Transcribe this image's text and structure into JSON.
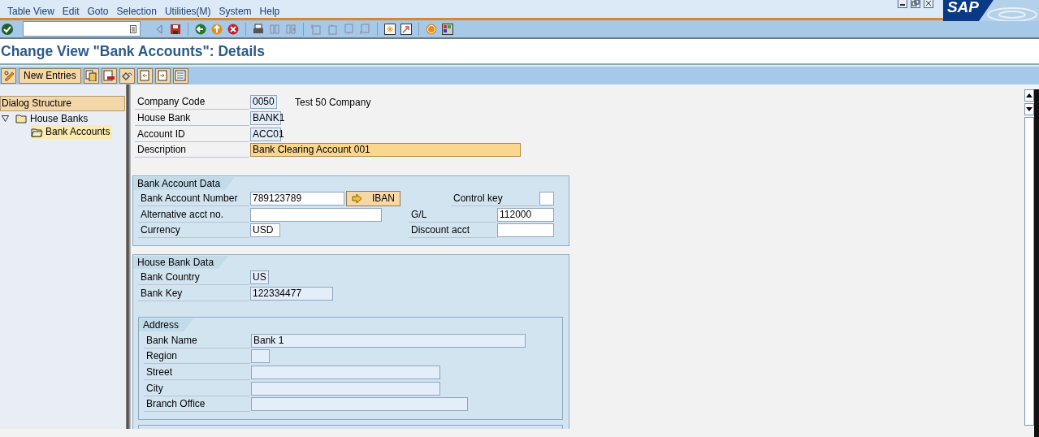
{
  "logo": "SAP",
  "menu": [
    "Table View",
    "Edit",
    "Goto",
    "Selection",
    "Utilities(M)",
    "System",
    "Help"
  ],
  "title": "Change View \"Bank Accounts\": Details",
  "app_toolbar": {
    "buttons": [
      "New Entries"
    ]
  },
  "dialog_structure": {
    "title": "Dialog Structure",
    "items": [
      {
        "label": "House Banks",
        "expanded": true,
        "selected": false,
        "children": [
          {
            "label": "Bank Accounts",
            "selected": true
          }
        ]
      }
    ]
  },
  "header_fields": [
    {
      "label": "Company Code",
      "value": "0050",
      "note": "Test 50 Company",
      "focused": false
    },
    {
      "label": "House Bank",
      "value": "BANK1",
      "focused": false
    },
    {
      "label": "Account ID",
      "value": "ACC01",
      "focused": false
    },
    {
      "label": "Description",
      "value": "Bank Clearing Account 001",
      "focused": true
    }
  ],
  "bank_account_data": {
    "title": "Bank Account Data",
    "rows": [
      {
        "left": {
          "label": "Bank Account Number",
          "value": "789123789",
          "button": "IBAN"
        },
        "right": {
          "label": "Control key"
        }
      },
      {
        "left": {
          "label": "Alternative acct no."
        },
        "right": {
          "label": "G/L",
          "value": "112000"
        }
      },
      {
        "left": {
          "label": "Currency",
          "value": "USD"
        },
        "right": {
          "label": "Discount acct"
        }
      }
    ]
  },
  "house_bank_data": {
    "title": "House Bank Data",
    "fields": [
      {
        "label": "Bank Country",
        "value": "US"
      },
      {
        "label": "Bank Key",
        "value": "122334477"
      }
    ],
    "address": {
      "title": "Address",
      "fields": [
        {
          "label": "Bank Name",
          "value": "Bank 1"
        },
        {
          "label": "Region"
        },
        {
          "label": "Street"
        },
        {
          "label": "City"
        },
        {
          "label": "Branch Office"
        }
      ]
    }
  }
}
